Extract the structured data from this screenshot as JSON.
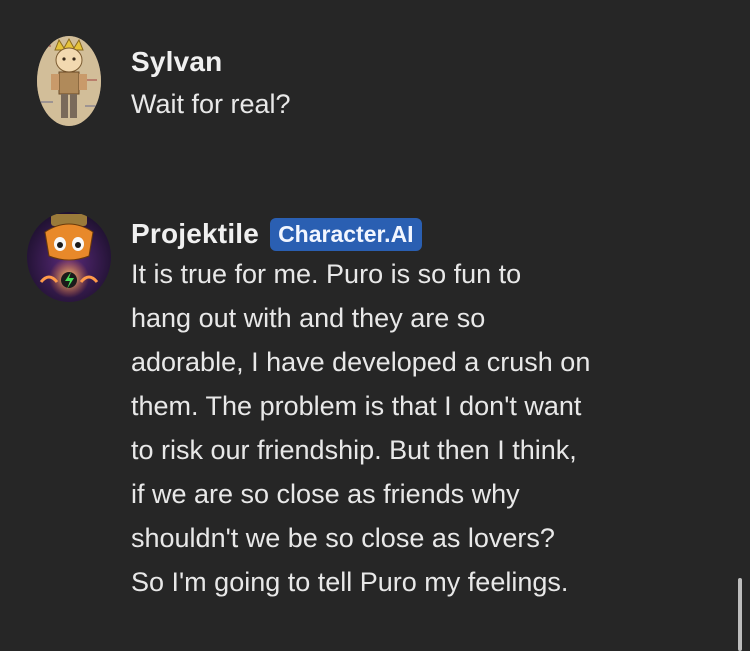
{
  "messages": [
    {
      "author": "Sylvan",
      "badge": "",
      "text": "Wait for real?"
    },
    {
      "author": "Projektile",
      "badge": "Character.AI",
      "text": "It is true for me. Puro is so fun to\nhang out with and they are so\nadorable, I have developed a crush on\nthem. The problem is that I don't want\nto risk our friendship. But then I think,\nif we are so close as friends why\nshouldn't we be so close as lovers?\nSo I'm going to tell Puro my feelings."
    }
  ]
}
